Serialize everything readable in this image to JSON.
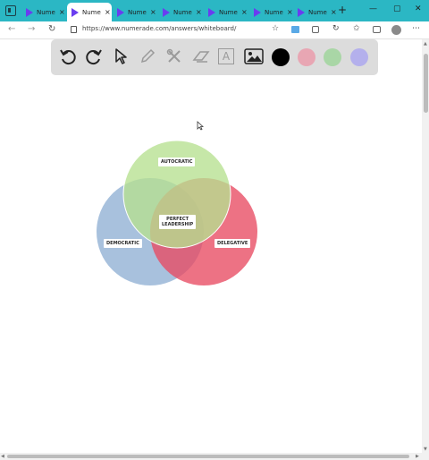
{
  "browser": {
    "tabs": [
      {
        "label": "Nume",
        "active": false
      },
      {
        "label": "Nume",
        "active": true
      },
      {
        "label": "Nume",
        "active": false
      },
      {
        "label": "Nume",
        "active": false
      },
      {
        "label": "Nume",
        "active": false
      },
      {
        "label": "Nume",
        "active": false
      },
      {
        "label": "Nume",
        "active": false
      }
    ],
    "close_glyph": "×",
    "new_tab_glyph": "+",
    "window_controls": {
      "minimize": "—",
      "maximize": "▢",
      "close": "✕"
    },
    "nav": {
      "back": "←",
      "forward": "→",
      "refresh": "↻"
    },
    "url": "https://www.numerade.com/answers/whiteboard/",
    "toolbar_glyphs": {
      "star": "☆",
      "favorites": "✩",
      "more": "⋯"
    }
  },
  "palette": {
    "tools": [
      "undo-icon",
      "redo-icon",
      "pointer-icon",
      "pen-icon",
      "tools-icon",
      "eraser-icon",
      "text-icon",
      "image-icon"
    ],
    "text_tool_glyph": "A",
    "colors": [
      "#000000",
      "#e8a6b3",
      "#a9d6a6",
      "#b4b0ec"
    ]
  },
  "diagram": {
    "labels": {
      "top": "AUTOCRATIC",
      "center_line1": "PERFECT",
      "center_line2": "LEADERSHIP",
      "left": "DEMOCRATIC",
      "right": "DELEGATIVE"
    },
    "colors": {
      "top": "#b6e08f",
      "left": "#8fb0d3",
      "right": "#e84a62"
    }
  },
  "scroll": {
    "up": "▲",
    "down": "▼",
    "left": "◀",
    "right": "▶"
  }
}
